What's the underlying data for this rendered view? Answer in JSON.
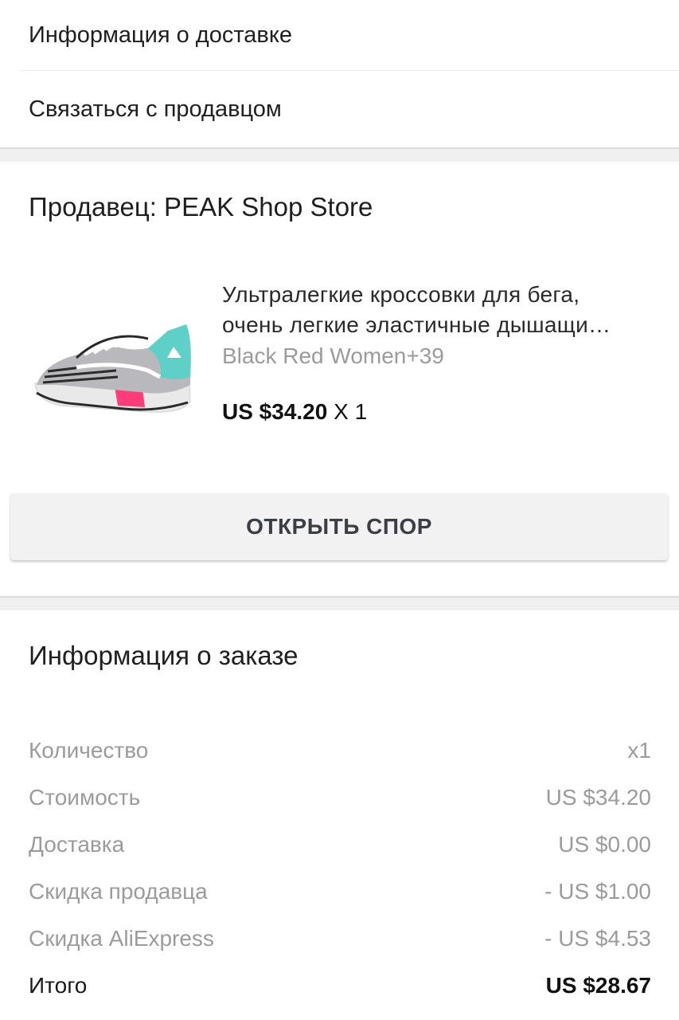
{
  "menu": {
    "delivery_info": "Информация о доставке",
    "contact_seller": "Связаться с продавцом"
  },
  "seller": {
    "label": "Продавец: PEAK Shop Store"
  },
  "product": {
    "title_line1": "Ультралегкие кроссовки для бега,",
    "title_line2": "очень легкие эластичные дышащи…",
    "variant": "Black Red Women+39",
    "price": "US $34.20",
    "quantity": "X 1",
    "image": "sneaker-image"
  },
  "dispute": {
    "button_label": "ОТКРЫТЬ СПОР"
  },
  "order": {
    "title": "Информация о заказе",
    "rows": [
      {
        "label": "Количество",
        "value": "x1"
      },
      {
        "label": "Стоимость",
        "value": "US $34.20"
      },
      {
        "label": "Доставка",
        "value": "US $0.00"
      },
      {
        "label": "Скидка продавца",
        "value": "- US $1.00"
      },
      {
        "label": "Скидка AliExpress",
        "value": "- US $4.53"
      },
      {
        "label": "Итого",
        "value": "US $28.67"
      }
    ]
  },
  "colors": {
    "accent_pink": "#ff3d7a",
    "accent_teal": "#5fd0c7",
    "muted_text": "#9b9b9b",
    "button_bg": "#f2f2f2"
  }
}
